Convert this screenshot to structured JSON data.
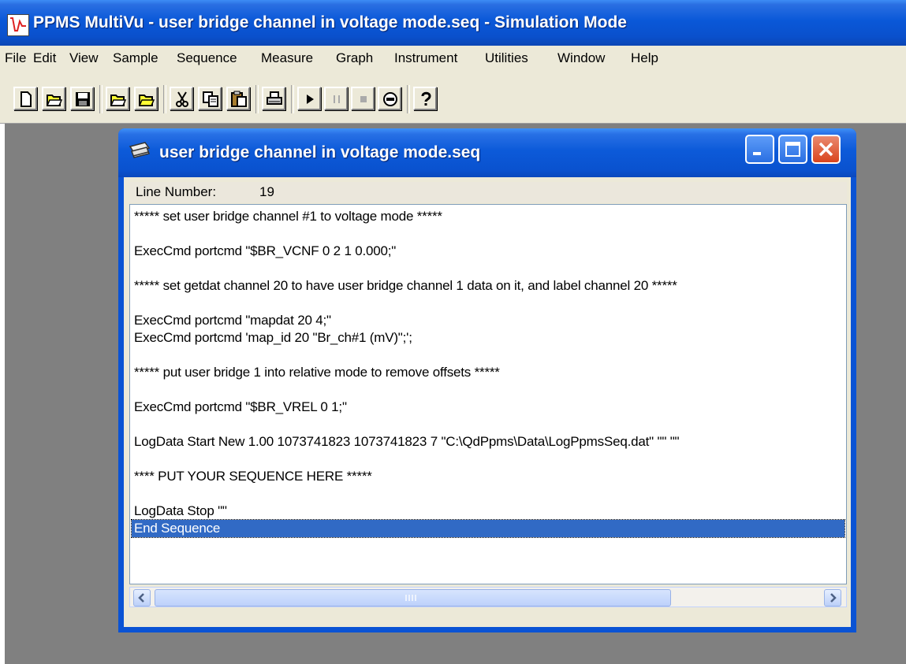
{
  "app": {
    "title": "PPMS MultiVu - user bridge channel in voltage mode.seq - Simulation Mode",
    "icon": "graph-icon"
  },
  "menu": [
    {
      "label": "File"
    },
    {
      "label": "Edit"
    },
    {
      "label": "View"
    },
    {
      "label": "Sample"
    },
    {
      "label": "Sequence"
    },
    {
      "label": "Measure"
    },
    {
      "label": "Graph"
    },
    {
      "label": "Instrument"
    },
    {
      "label": "Utilities"
    },
    {
      "label": "Window"
    },
    {
      "label": "Help"
    }
  ],
  "toolbar": {
    "buttons": [
      "new-icon",
      "open-icon",
      "save-icon",
      "open-sequence-icon",
      "open-data-icon",
      "cut-icon",
      "copy-icon",
      "paste-icon",
      "print-icon",
      "run-icon",
      "pause-icon",
      "stop-icon",
      "abort-icon",
      "help-icon"
    ]
  },
  "document": {
    "title": "user bridge channel in voltage mode.seq",
    "line_number_label": "Line Number:",
    "line_number_value": "19",
    "lines": [
      "***** set user bridge channel #1 to voltage mode *****",
      "",
      "ExecCmd portcmd \"$BR_VCNF 0 2 1 0.000;\"",
      "",
      "***** set getdat channel 20 to have user bridge channel 1 data on it, and label channel 20 *****",
      "",
      "ExecCmd portcmd \"mapdat 20 4;\"",
      "ExecCmd portcmd 'map_id 20 \"Br_ch#1 (mV)\";';",
      "",
      "***** put user bridge 1 into relative mode to remove offsets *****",
      "",
      "ExecCmd portcmd \"$BR_VREL 0 1;\"",
      "",
      "LogData Start New 1.00 1073741823 1073741823 7 \"C:\\QdPpms\\Data\\LogPpmsSeq.dat\" \"\" \"\"",
      "",
      "**** PUT YOUR SEQUENCE HERE *****",
      "",
      "LogData Stop \"\"",
      "End Sequence"
    ],
    "selected_line": 18
  },
  "colors": {
    "titlebar": "#0a58d8",
    "selection": "#316ac5",
    "mdi_background": "#808080",
    "menu_background": "#ece9d8"
  }
}
